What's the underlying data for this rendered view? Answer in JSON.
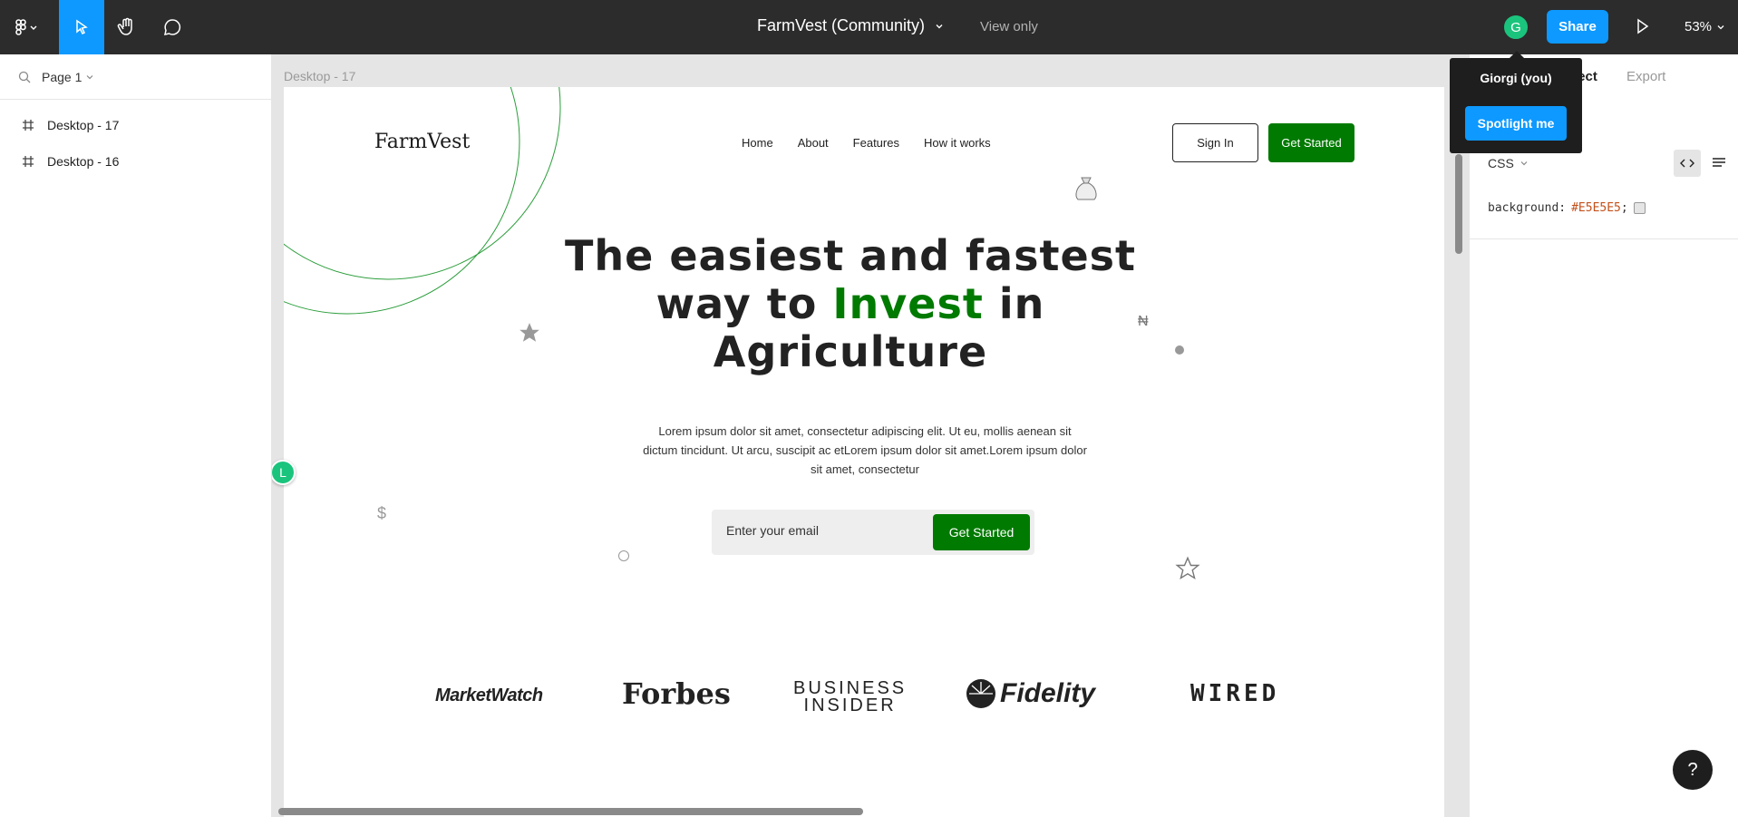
{
  "topbar": {
    "title": "FarmVest (Community)",
    "view_mode": "View only",
    "user_initial": "G",
    "share_label": "Share",
    "zoom": "53%"
  },
  "left_panel": {
    "page_label": "Page 1",
    "layers": [
      "Desktop - 17",
      "Desktop - 16"
    ]
  },
  "canvas": {
    "frame_label": "Desktop - 17",
    "collaborator_initial": "L",
    "site": {
      "logo": "FarmVest",
      "nav": [
        "Home",
        "About",
        "Features",
        "How it works"
      ],
      "signin": "Sign In",
      "cta_nav": "Get Started",
      "headline_1": "The easiest and fastest",
      "headline_2a": "way to ",
      "headline_highlight": "Invest",
      "headline_2b": " in",
      "headline_3": "Agriculture",
      "body": "Lorem ipsum dolor sit amet, consectetur adipiscing elit. Ut eu, mollis aenean sit dictum tincidunt. Ut arcu, suscipit ac etLorem ipsum dolor sit amet.Lorem ipsum dolor sit amet, consectetur",
      "email_placeholder": "Enter your email",
      "cta_email": "Get Started",
      "brands": [
        "MarketWatch",
        "Forbes",
        "BUSINESS",
        "INSIDER",
        "Fidelity",
        "WIRED"
      ],
      "deco_symbols": [
        "$",
        "₦"
      ]
    }
  },
  "right_panel": {
    "tab_inspect": "pect",
    "tab_export": "Export",
    "code_lang": "CSS",
    "code_property": "background:",
    "code_value": "#E5E5E5",
    "code_end": ";"
  },
  "popover": {
    "name": "Giorgi (you)",
    "button": "Spotlight me"
  },
  "colors": {
    "accent": "#0d99ff",
    "brand_green": "#007a00",
    "topbar": "#2c2c2c",
    "presence": "#1bc47d"
  }
}
